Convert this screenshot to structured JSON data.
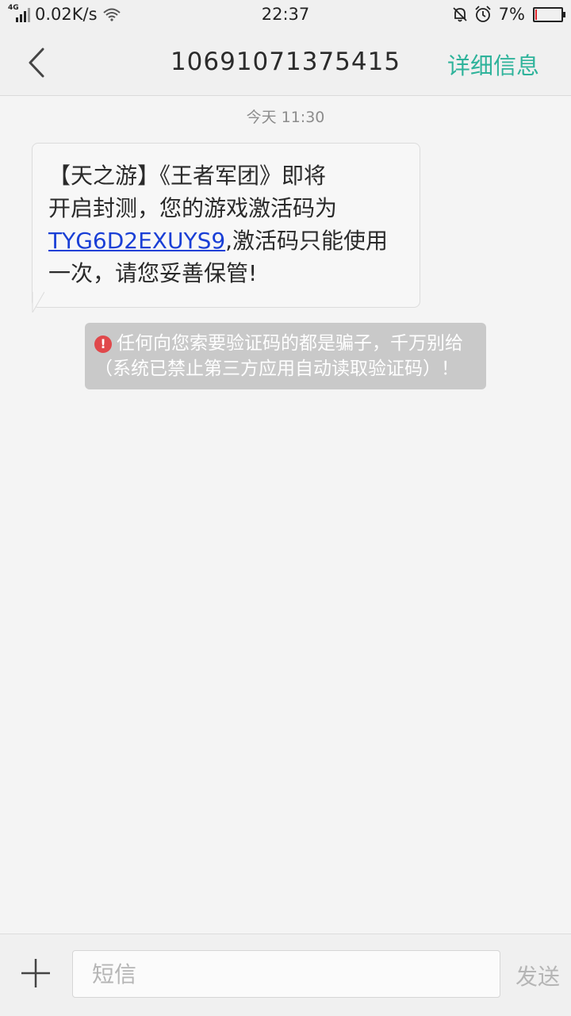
{
  "status_bar": {
    "network_type": "4G",
    "speed": "0.02K/s",
    "time": "22:37",
    "battery_percent": "7%",
    "battery_level": 0.07,
    "battery_color": "#e3262d"
  },
  "header": {
    "title": "10691071375415",
    "detail_label": "详细信息",
    "accent_color": "#2fb39b"
  },
  "conversation": {
    "timestamp": "今天 11:30",
    "message": {
      "line1": "【天之游】《王者军团》即将",
      "line2": "开启封测，您的游戏激活码为",
      "code": "TYG6D2EXUYS9",
      "after_code": ",激活码只能使用",
      "line4": "一次，请您妥善保管!"
    },
    "warning": {
      "icon": "!",
      "text": "任何向您索要验证码的都是骗子，千万别给（系统已禁止第三方应用自动读取验证码）！"
    }
  },
  "composer": {
    "placeholder": "短信",
    "send_label": "发送"
  }
}
